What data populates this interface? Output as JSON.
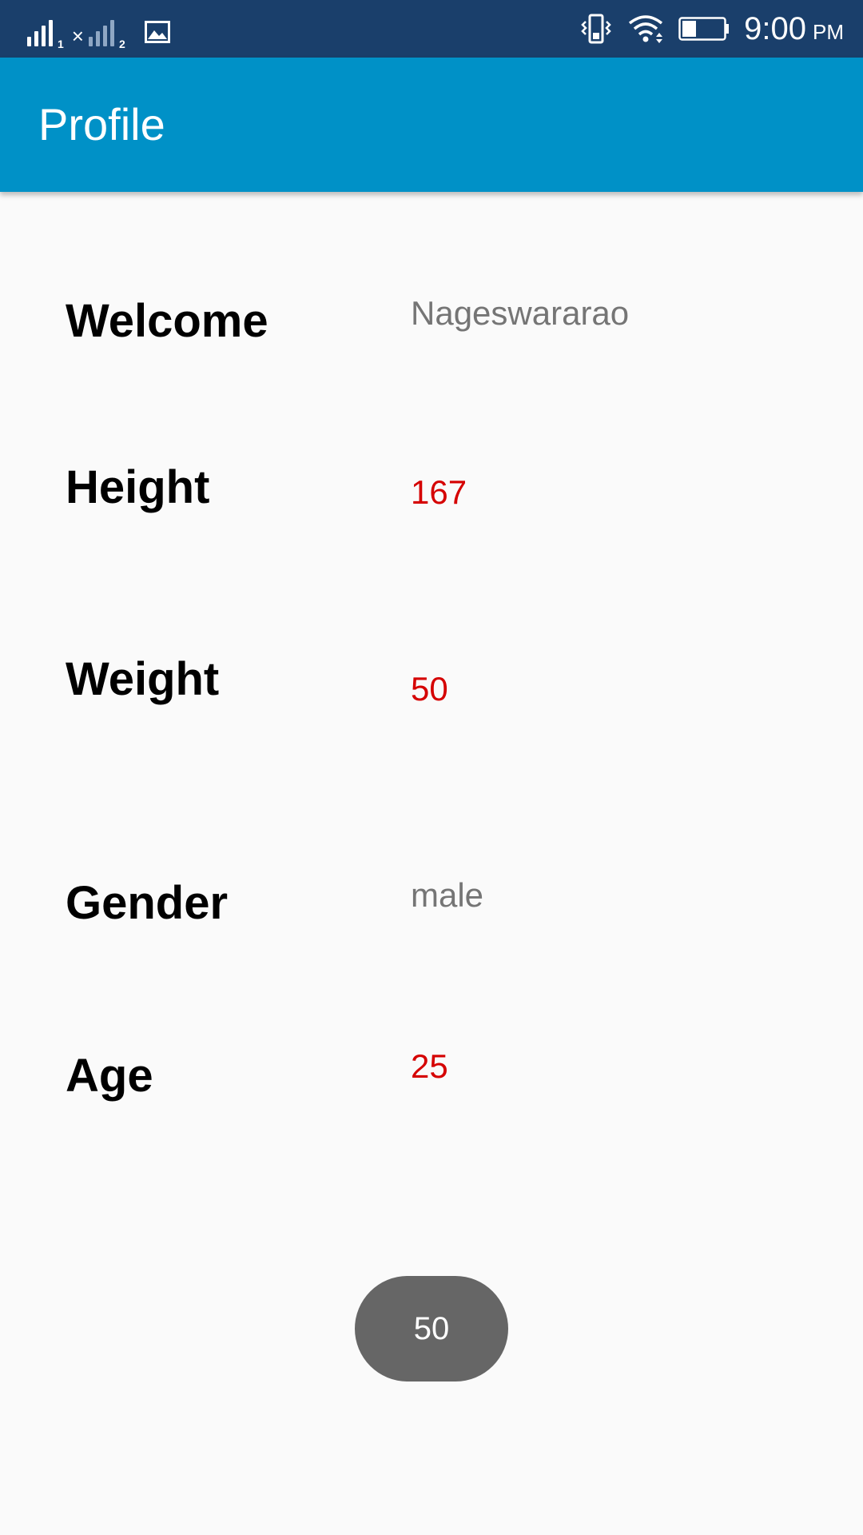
{
  "status_bar": {
    "sim1_label": "1",
    "sim2_label": "2",
    "sim2_x": "×",
    "time": "9:00",
    "ampm": "PM",
    "icons": [
      "signal-sim1-icon",
      "signal-sim2-icon",
      "image-notification-icon",
      "vibrate-icon",
      "wifi-icon",
      "battery-icon"
    ]
  },
  "app_bar": {
    "title": "Profile",
    "color": "#0091c7"
  },
  "profile": {
    "welcome_label": "Welcome",
    "welcome_value": "Nageswararao",
    "height_label": "Height",
    "height_value": "167",
    "weight_label": "Weight",
    "weight_value": "50",
    "gender_label": "Gender",
    "gender_value": "male",
    "age_label": "Age",
    "age_value": "25"
  },
  "toast": {
    "text": "50"
  },
  "colors": {
    "status_bar": "#1a3f6b",
    "accent_value": "#d50000",
    "muted_value": "#757575"
  }
}
